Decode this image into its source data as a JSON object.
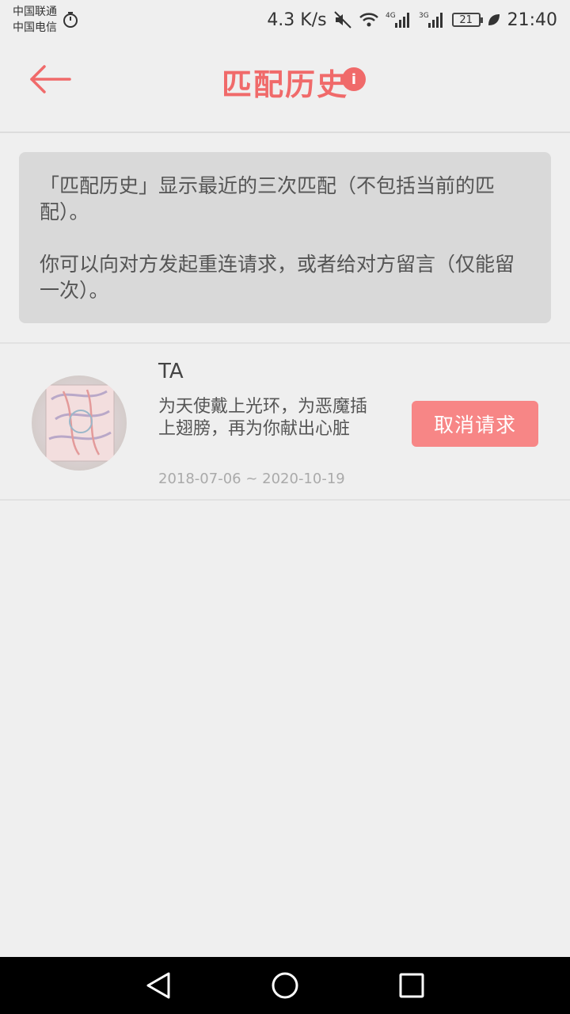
{
  "statusbar": {
    "carrier1": "中国联通",
    "carrier2": "中国电信",
    "speed": "4.3 K/s",
    "net1": "4G",
    "net2": "3G",
    "battery": "21",
    "time": "21:40"
  },
  "header": {
    "title": "匹配历史",
    "info_glyph": "i"
  },
  "notice": {
    "line1": "「匹配历史」显示最近的三次匹配（不包括当前的匹配）。",
    "line2": "你可以向对方发起重连请求，或者给对方留言（仅能留一次）。"
  },
  "matches": [
    {
      "name": "TA",
      "bio": "为天使戴上光环，为恶魔插上翅膀，再为你献出心脏",
      "dates": "2018-07-06 ~ 2020-10-19",
      "action_label": "取消请求"
    }
  ],
  "colors": {
    "accent": "#f06a6a",
    "button": "#f78686"
  },
  "icons": {
    "back": "arrow-left-icon",
    "info": "info-icon",
    "nav_back": "triangle-back-icon",
    "nav_home": "circle-home-icon",
    "nav_recent": "square-recent-icon"
  }
}
